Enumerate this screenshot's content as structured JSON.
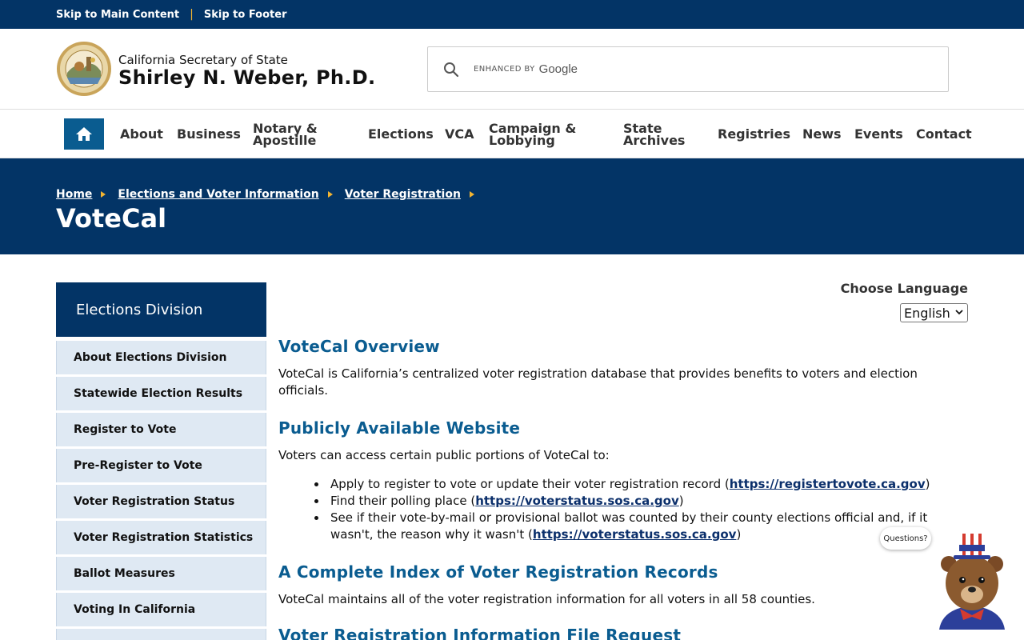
{
  "skip": {
    "main": "Skip to Main Content",
    "sep": "|",
    "footer": "Skip to Footer"
  },
  "brand": {
    "office": "California Secretary of State",
    "name": "Shirley N. Weber, Ph.D."
  },
  "search": {
    "enhanced": "ENHANCED BY",
    "google": "Google"
  },
  "nav": {
    "about": "About",
    "business": "Business",
    "notary1": "Notary &",
    "notary2": "Apostille",
    "elections": "Elections",
    "vca": "VCA",
    "campaign1": "Campaign &",
    "campaign2": "Lobbying",
    "archives1": "State",
    "archives2": "Archives",
    "registries": "Registries",
    "news": "News",
    "events": "Events",
    "contact": "Contact"
  },
  "breadcrumb": {
    "home": "Home",
    "elections": "Elections and Voter Information",
    "voter_reg": "Voter Registration"
  },
  "page_title": "VoteCal",
  "sidebar": {
    "heading": "Elections Division",
    "items": [
      "About Elections Division",
      "Statewide Election Results",
      "Register to Vote",
      "Pre-Register to Vote",
      "Voter Registration Status",
      "Voter Registration Statistics",
      "Ballot Measures",
      "Voting In California"
    ]
  },
  "language": {
    "label": "Choose Language",
    "selected": "English"
  },
  "content": {
    "h_overview": "VoteCal Overview",
    "p_overview_1": "VoteCal is California’s centralized voter registration database that provides benefits to voters and election",
    "p_overview_2": "officials.",
    "h_website": "Publicly Available Website",
    "p_website": "Voters can access certain public portions of VoteCal to:",
    "b1_text": "Apply to register to vote or update their voter registration record (",
    "b1_link": "https://registertovote.ca.gov",
    "b1_end": ")",
    "b2_text": "Find their polling place (",
    "b2_link": "https://voterstatus.sos.ca.gov",
    "b2_end": ")",
    "b3_line1": "See if their vote-by-mail or provisional ballot was counted by their county elections official and, if it",
    "b3_text2": "wasn't, the reason why it wasn't (",
    "b3_link": "https://voterstatus.sos.ca.gov",
    "b3_end": ")",
    "h_index": "A Complete Index of Voter Registration Records",
    "p_index": "VoteCal maintains all of the voter registration information for all voters in all 58 counties.",
    "h_request": "Voter Registration Information File Request"
  },
  "chat": {
    "bubble": "Questions?"
  },
  "colors": {
    "navy": "#033466",
    "link_blue": "#0a5c90",
    "gold": "#f2b431",
    "sidebar_bg": "#dfe9f3"
  }
}
